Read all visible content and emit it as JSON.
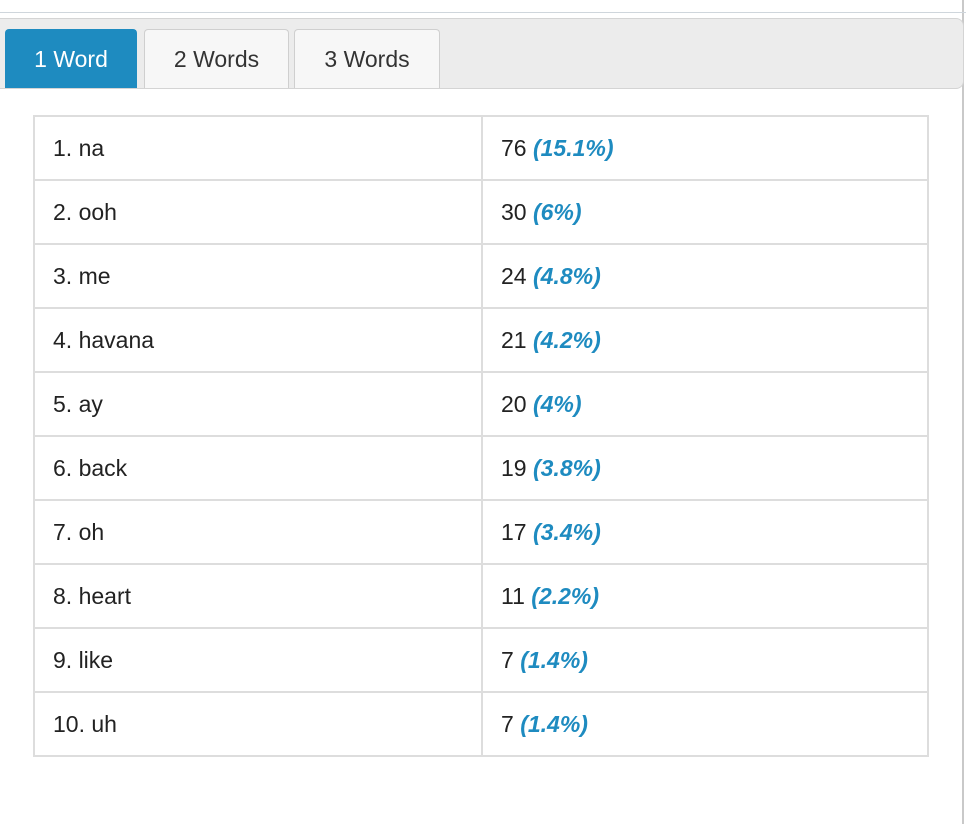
{
  "tabs": [
    {
      "label": "1 Word",
      "active": true
    },
    {
      "label": "2 Words",
      "active": false
    },
    {
      "label": "3 Words",
      "active": false
    }
  ],
  "colors": {
    "accent": "#1e8bc0",
    "tab_bg": "#f7f7f7",
    "border": "#dddddd"
  },
  "rows": [
    {
      "word": "1. na",
      "count": "76",
      "pct": "(15.1%)"
    },
    {
      "word": "2. ooh",
      "count": "30",
      "pct": "(6%)"
    },
    {
      "word": "3. me",
      "count": "24",
      "pct": "(4.8%)"
    },
    {
      "word": "4. havana",
      "count": "21",
      "pct": "(4.2%)"
    },
    {
      "word": "5. ay",
      "count": "20",
      "pct": "(4%)"
    },
    {
      "word": "6. back",
      "count": "19",
      "pct": "(3.8%)"
    },
    {
      "word": "7. oh",
      "count": "17",
      "pct": "(3.4%)"
    },
    {
      "word": "8. heart",
      "count": "11",
      "pct": "(2.2%)"
    },
    {
      "word": "9. like",
      "count": "7",
      "pct": "(1.4%)"
    },
    {
      "word": "10. uh",
      "count": "7",
      "pct": "(1.4%)"
    }
  ]
}
